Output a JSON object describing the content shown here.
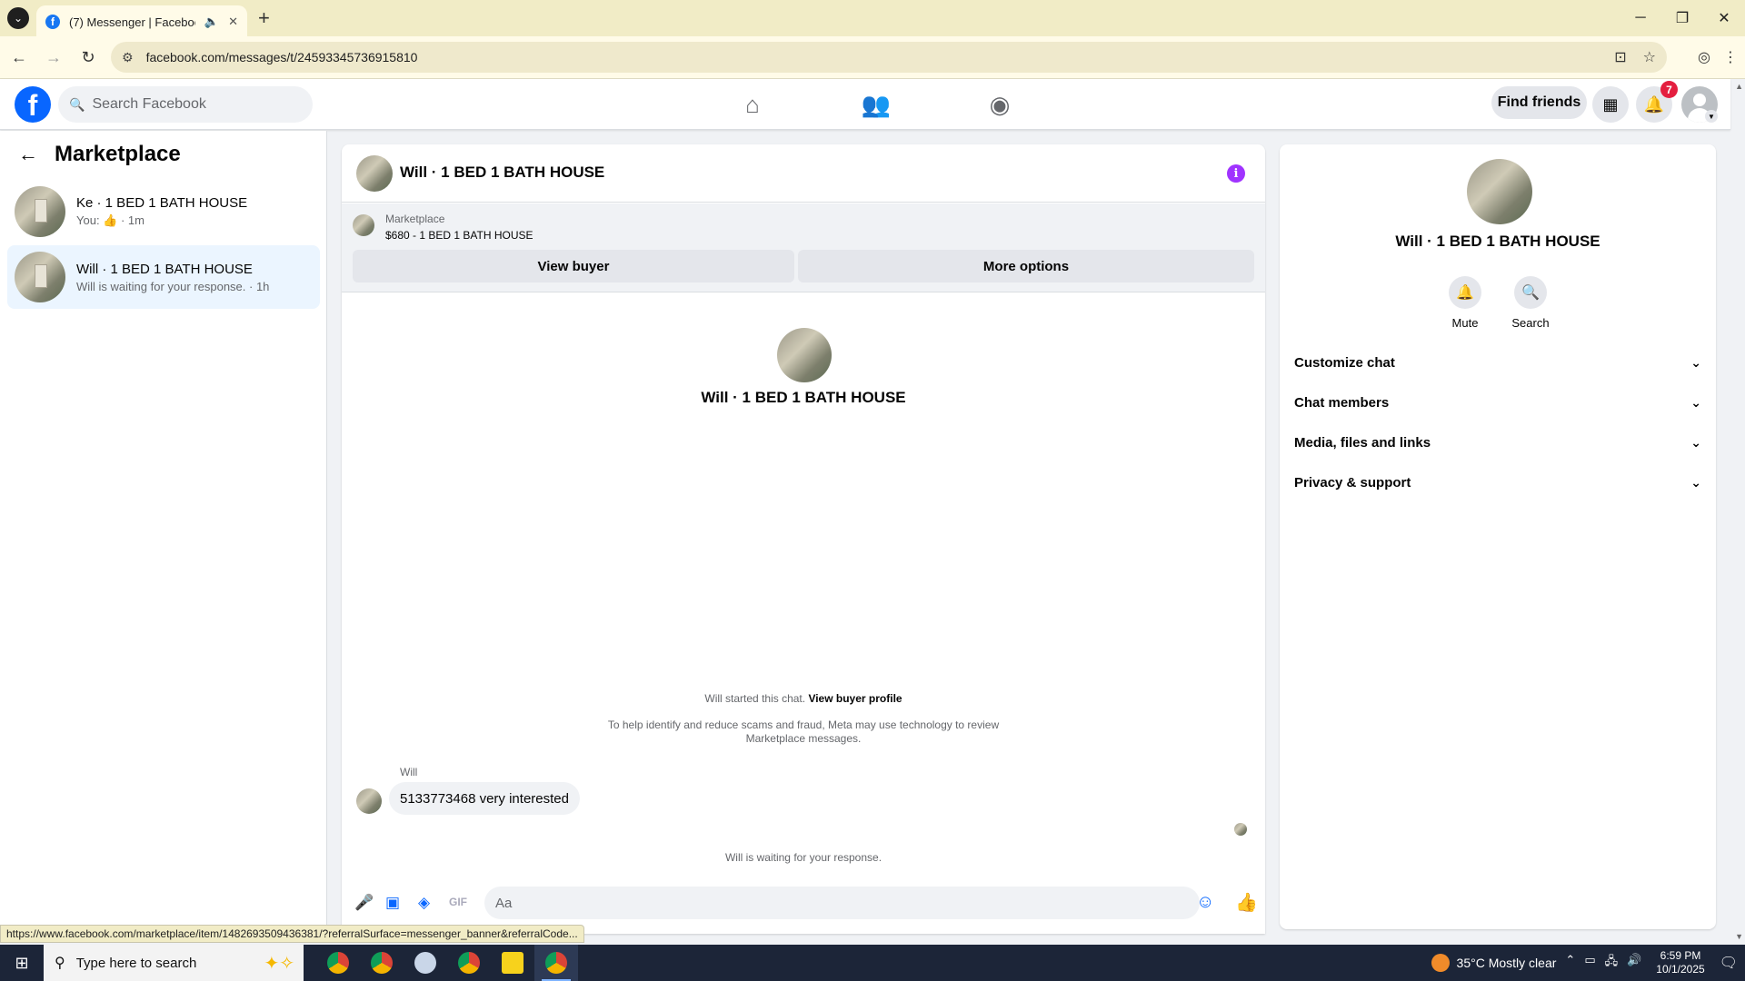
{
  "browser": {
    "tab_title": "(7) Messenger | Facebook",
    "tab_favicon": "f",
    "url": "facebook.com/messages/t/24593345736915810",
    "status_url": "https://www.facebook.com/marketplace/item/1482693509436381/?referralSurface=messenger_banner&referralCode..."
  },
  "header": {
    "search_placeholder": "Search Facebook",
    "find_friends": "Find friends",
    "notification_count": "7",
    "logo": "f"
  },
  "left": {
    "title": "Marketplace",
    "conversations": [
      {
        "name": "Ke · 1 BED 1 BATH HOUSE",
        "sub": "You: 👍 · 1m"
      },
      {
        "name": "Will · 1 BED 1 BATH HOUSE",
        "sub": "Will is waiting for your response. · 1h"
      }
    ]
  },
  "chat": {
    "title": "Will · 1 BED 1 BATH HOUSE",
    "marketplace_label": "Marketplace",
    "listing": "$680 - 1 BED 1 BATH HOUSE",
    "view_buyer": "View buyer",
    "more_options": "More options",
    "center_name": "Will · 1 BED 1 BATH HOUSE",
    "started_text": "Will started this chat.",
    "view_profile": "View buyer profile",
    "notice": "To help identify and reduce scams and fraud, Meta may use technology to review Marketplace messages.",
    "sender": "Will",
    "message": "5133773468 very interested",
    "waiting": "Will is waiting for your response.",
    "composer_placeholder": "Aa",
    "gif_label": "GIF"
  },
  "right": {
    "name": "Will · 1 BED 1 BATH HOUSE",
    "mute": "Mute",
    "search": "Search",
    "sections": [
      "Customize chat",
      "Chat members",
      "Media, files and links",
      "Privacy & support"
    ]
  },
  "taskbar": {
    "search_placeholder": "Type here to search",
    "weather": "35°C  Mostly clear",
    "time": "6:59 PM",
    "date": "10/1/2025"
  },
  "colors": {
    "fb_blue": "#0866ff",
    "info_purple": "#a033ff",
    "badge_red": "#e41e3f",
    "active_conv": "#ebf5ff"
  }
}
